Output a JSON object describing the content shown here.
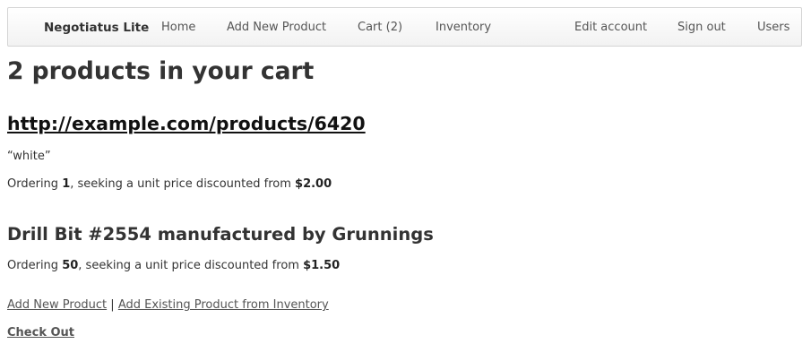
{
  "nav": {
    "brand": "Negotiatus Lite",
    "links": [
      "Home",
      "Add New Product",
      "Cart (2)",
      "Inventory"
    ],
    "right_links": [
      "Edit account",
      "Sign out",
      "Users"
    ]
  },
  "main": {
    "title": "2 products in your cart",
    "products": [
      {
        "name": "http://example.com/products/6420",
        "note": "“white”",
        "ordering_prefix": "Ordering ",
        "quantity": "1",
        "ordering_middle": ", seeking a unit price discounted from ",
        "price": "$2.00"
      },
      {
        "name": "Drill Bit #2554 manufactured by Grunnings",
        "ordering_prefix": "Ordering ",
        "quantity": "50",
        "ordering_middle": ", seeking a unit price discounted from ",
        "price": "$1.50"
      }
    ],
    "actions": {
      "add_new": "Add New Product",
      "separator": "|",
      "add_existing": "Add Existing Product from Inventory",
      "checkout": "Check Out"
    }
  }
}
